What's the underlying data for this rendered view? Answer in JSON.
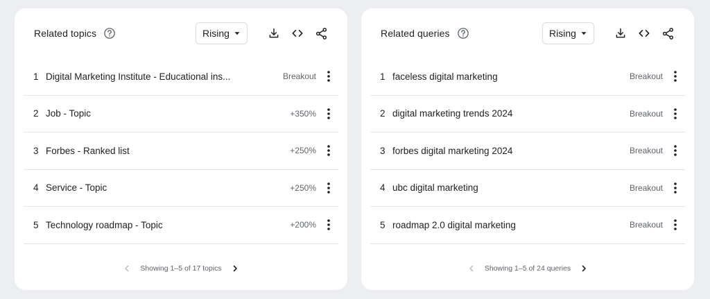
{
  "colors": {
    "background": "#eceef1",
    "card": "#ffffff",
    "text": "#202124",
    "muted": "#5f6368",
    "divider": "#e3e3e3",
    "disabled": "#bdc1c6"
  },
  "panels": [
    {
      "title": "Related topics",
      "dropdown": {
        "selected": "Rising"
      },
      "icons": [
        "help-icon",
        "download-icon",
        "embed-code-icon",
        "share-icon",
        "more-vert-icon",
        "chevron-left-icon",
        "chevron-right-icon"
      ],
      "rows": [
        {
          "rank": "1",
          "label": "Digital Marketing Institute - Educational ins...",
          "value": "Breakout"
        },
        {
          "rank": "2",
          "label": "Job - Topic",
          "value": "+350%"
        },
        {
          "rank": "3",
          "label": "Forbes - Ranked list",
          "value": "+250%"
        },
        {
          "rank": "4",
          "label": "Service - Topic",
          "value": "+250%"
        },
        {
          "rank": "5",
          "label": "Technology roadmap - Topic",
          "value": "+200%"
        }
      ],
      "pager": "Showing 1–5 of 17 topics"
    },
    {
      "title": "Related queries",
      "dropdown": {
        "selected": "Rising"
      },
      "icons": [
        "help-icon",
        "download-icon",
        "embed-code-icon",
        "share-icon",
        "more-vert-icon",
        "chevron-left-icon",
        "chevron-right-icon"
      ],
      "rows": [
        {
          "rank": "1",
          "label": "faceless digital marketing",
          "value": "Breakout"
        },
        {
          "rank": "2",
          "label": "digital marketing trends 2024",
          "value": "Breakout"
        },
        {
          "rank": "3",
          "label": "forbes digital marketing 2024",
          "value": "Breakout"
        },
        {
          "rank": "4",
          "label": "ubc digital marketing",
          "value": "Breakout"
        },
        {
          "rank": "5",
          "label": "roadmap 2.0 digital marketing",
          "value": "Breakout"
        }
      ],
      "pager": "Showing 1–5 of 24 queries"
    }
  ]
}
